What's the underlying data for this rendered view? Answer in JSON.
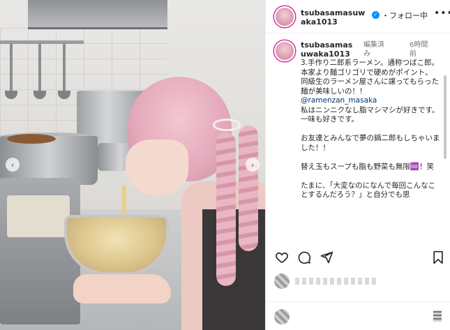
{
  "header": {
    "username": "tsubasamasuwaka1013",
    "verified_icon": "verified-badge-icon",
    "follow_label": "・フォロー中",
    "more_icon": "more-horizontal-icon",
    "more_label": "•••"
  },
  "comment": {
    "username": "tsubasamasuwaka1013",
    "edited_label": "編集済み",
    "time_label": "6時間前",
    "text_1": "3.手作り二郎系ラーメン。通称つばこ郎。\n本家より麺ゴリゴリで硬めがポイント。\n同級生のラーメン屋さんに譲ってもらった麺が美味しいの！！\n",
    "mention": "@ramenzan_masaka",
    "text_2": "\n私はニンニクなし脂マシマシが好きです。一味も好きです。\n\nお友達とみんなで夢の鍋二郎もしちゃいました！！\n\n替え玉もスープも脂も野菜も無限♾️！笑\n\nたまに、「大変なのになんで毎回こんなことするんだろう？」と自分でも思"
  },
  "carousel": {
    "prev_label": "‹",
    "next_label": "›"
  },
  "actions": {
    "like_icon": "heart-icon",
    "comment_icon": "comment-icon",
    "share_icon": "send-icon",
    "save_icon": "bookmark-icon"
  },
  "colors": {
    "verified": "#0095f6",
    "mention": "#00376b",
    "story_ring": "#d6249f"
  }
}
